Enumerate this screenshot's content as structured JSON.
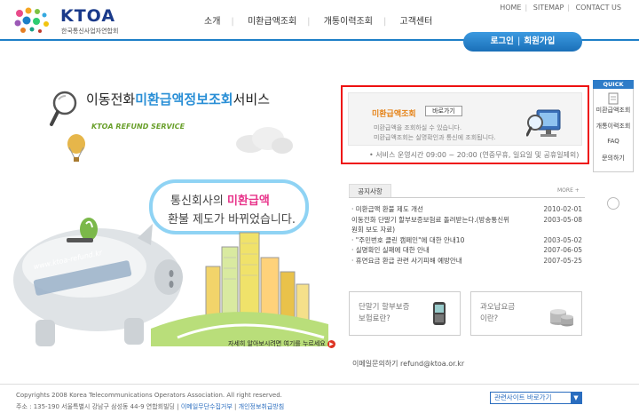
{
  "header": {
    "logo_text": "KTOA",
    "logo_sub": "한국통신사업자연합회",
    "util_links": [
      "HOME",
      "SITEMAP",
      "CONTACT US"
    ],
    "nav": [
      "소개",
      "미환급액조회",
      "개통이력조회",
      "고객센터"
    ],
    "login": "로그인",
    "join": "회원가입"
  },
  "hero": {
    "title_pre": "이동전화",
    "title_hl": "미환급액정보조회",
    "title_post": "서비스",
    "subtitle": "KTOA REFUND SERVICE",
    "bubble_l1_pre": "통신회사의 ",
    "bubble_l1_hl": "미환급액",
    "bubble_l2": "환불 제도가 바뀌었습니다.",
    "pig_url": "www.ktoa-refund.kr",
    "more_info": "자세히 알아보시려면 여기를 누르세요"
  },
  "refund": {
    "title": "미환급액조회",
    "button": "바로가기",
    "desc1": "미환급액을 조회하실 수 있습니다.",
    "desc2": "미환급액조회는 실명확인과 통신에 조회됩니다.",
    "hours": "• 서비스 운영시간 09:00 ~ 20:00 (연중무휴, 일요일 및 공휴일제외)"
  },
  "quick": {
    "head": "QUICK",
    "items": [
      "미환급액조회",
      "개통이력조회",
      "FAQ",
      "문의하기"
    ]
  },
  "notices": {
    "tab": "공지사항",
    "more": "MORE",
    "rows": [
      {
        "title": "· 미환급액 환불 제도 개선",
        "date": "2010-02-01"
      },
      {
        "title": "  이동전화 단말기 할부보증보험료 돌려받는다.(방송통신위",
        "date": "2003-05-08"
      },
      {
        "title": "  원회 보도 자료)",
        "date": ""
      },
      {
        "title": "· \"주민번호 클린 캠페인\"에 대한 안내10",
        "date": "2003-05-02"
      },
      {
        "title": "· 실명확인 실패에 대한 안내",
        "date": "2007-06-05"
      },
      {
        "title": "· 휴면요금 환급 관련 사기피해 예방안내",
        "date": "2007-05-25"
      }
    ]
  },
  "promos": [
    {
      "line1": "단말기 할부보증",
      "line2": "보험료란?"
    },
    {
      "line1": "과오납요금",
      "line2": "이란?"
    }
  ],
  "email": "이메일문의하기  refund@ktoa.or.kr",
  "footer": {
    "copyright": "Copyrights 2008 Korea Telecommunications Operators Association. All right reserved.",
    "address": "주소 : 135-190 서울특별시 강남구 삼성동 44-9 연합회빌딩",
    "link1": "이메일무단수집거부",
    "link2": "개인정보취급방침",
    "related": "관련사이트 바로가기"
  },
  "colors": {
    "brand_blue": "#1e7fc7",
    "highlight_pink": "#e8348a",
    "accent_orange": "#e58318",
    "alert_red": "#e11111"
  }
}
